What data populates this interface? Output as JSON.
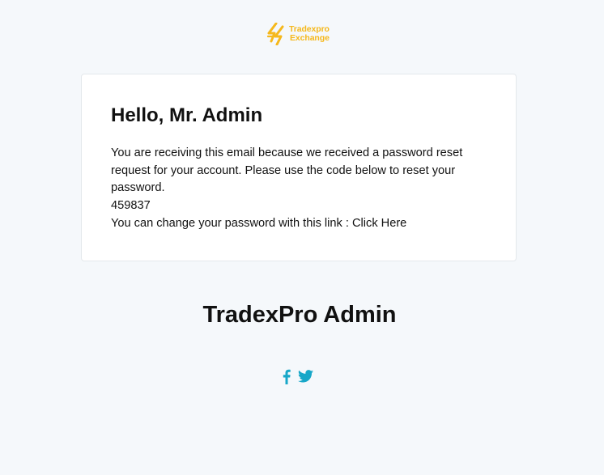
{
  "brand": {
    "logo_line1": "Tradexpro",
    "logo_line2": "Exchange",
    "logo_color": "#f5b81c"
  },
  "email": {
    "greeting": "Hello, Mr. Admin",
    "message": "You are receiving this email because we received a password reset request for your account. Please use the code below to reset your password.",
    "code": "459837",
    "link_prefix": "You can change your password with this link : ",
    "link_label": "Click Here"
  },
  "footer": {
    "signature": "TradexPro Admin",
    "social": [
      {
        "name": "facebook",
        "icon": "facebook-icon"
      },
      {
        "name": "twitter",
        "icon": "twitter-icon"
      }
    ],
    "icon_color": "#17a7c8"
  },
  "colors": {
    "background": "#f5f8fb",
    "card": "#ffffff"
  }
}
